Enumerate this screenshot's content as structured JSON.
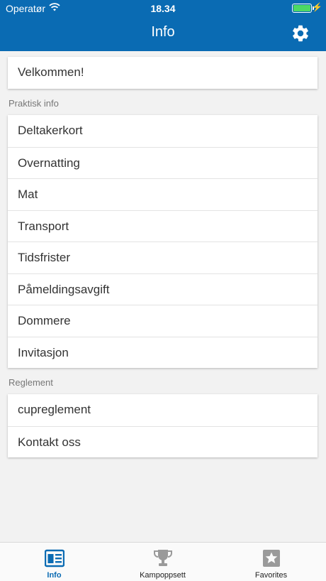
{
  "status": {
    "carrier": "Operatør",
    "time": "18.34",
    "wifi_icon": "wifi-icon",
    "battery_icon": "battery-icon"
  },
  "header": {
    "title": "Info",
    "settings_icon": "gear-icon"
  },
  "welcome": {
    "label": "Velkommen!"
  },
  "practical": {
    "title": "Praktisk info",
    "items": [
      "Deltakerkort",
      "Overnatting",
      "Mat",
      "Transport",
      "Tidsfrister",
      "Påmeldingsavgift",
      "Dommere",
      "Invitasjon"
    ]
  },
  "rules": {
    "title": "Reglement",
    "items": [
      "cupreglement",
      "Kontakt oss"
    ]
  },
  "tabs": [
    {
      "label": "Info",
      "icon": "newspaper-icon",
      "active": true
    },
    {
      "label": "Kampoppsett",
      "icon": "trophy-icon",
      "active": false
    },
    {
      "label": "Favorites",
      "icon": "star-icon",
      "active": false
    }
  ],
  "colors": {
    "header": "#0a6bb3",
    "active_tab": "#0a6bb3",
    "inactive_tab": "#9a9a9a"
  }
}
